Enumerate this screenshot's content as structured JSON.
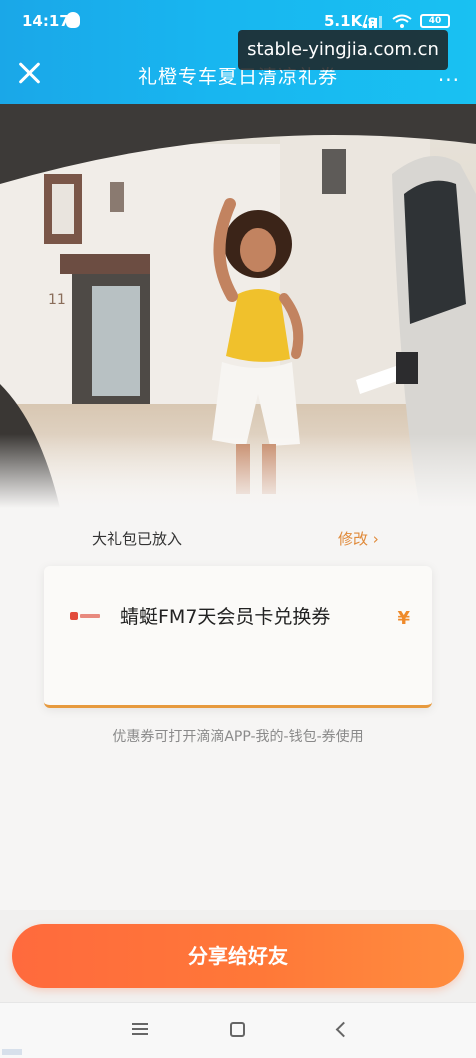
{
  "status_bar": {
    "time": "14:17",
    "speed": "5.1K/s",
    "battery": "40"
  },
  "header": {
    "title": "礼橙专车夏日清凉礼券",
    "more": "···"
  },
  "watermark": "stable-yingjia.com.cn",
  "gift": {
    "label": "大礼包已放入",
    "edit": "修改 ›"
  },
  "coupon": {
    "name": "蜻蜓FM7天会员卡兑换券",
    "currency_symbol": "¥"
  },
  "hint": "优惠券可打开滴滴APP-我的-钱包-券使用",
  "share_button": "分享给好友",
  "colors": {
    "header_blue": "#19b3ee",
    "accent_orange": "#ff7838",
    "edit_orange": "#e08a3a"
  },
  "icons": [
    "close-icon",
    "more-icon",
    "qq-icon",
    "signal-icon",
    "wifi-icon",
    "battery-icon",
    "brand-logo",
    "yen-icon",
    "nav-menu-icon",
    "nav-home-icon",
    "nav-back-icon"
  ]
}
